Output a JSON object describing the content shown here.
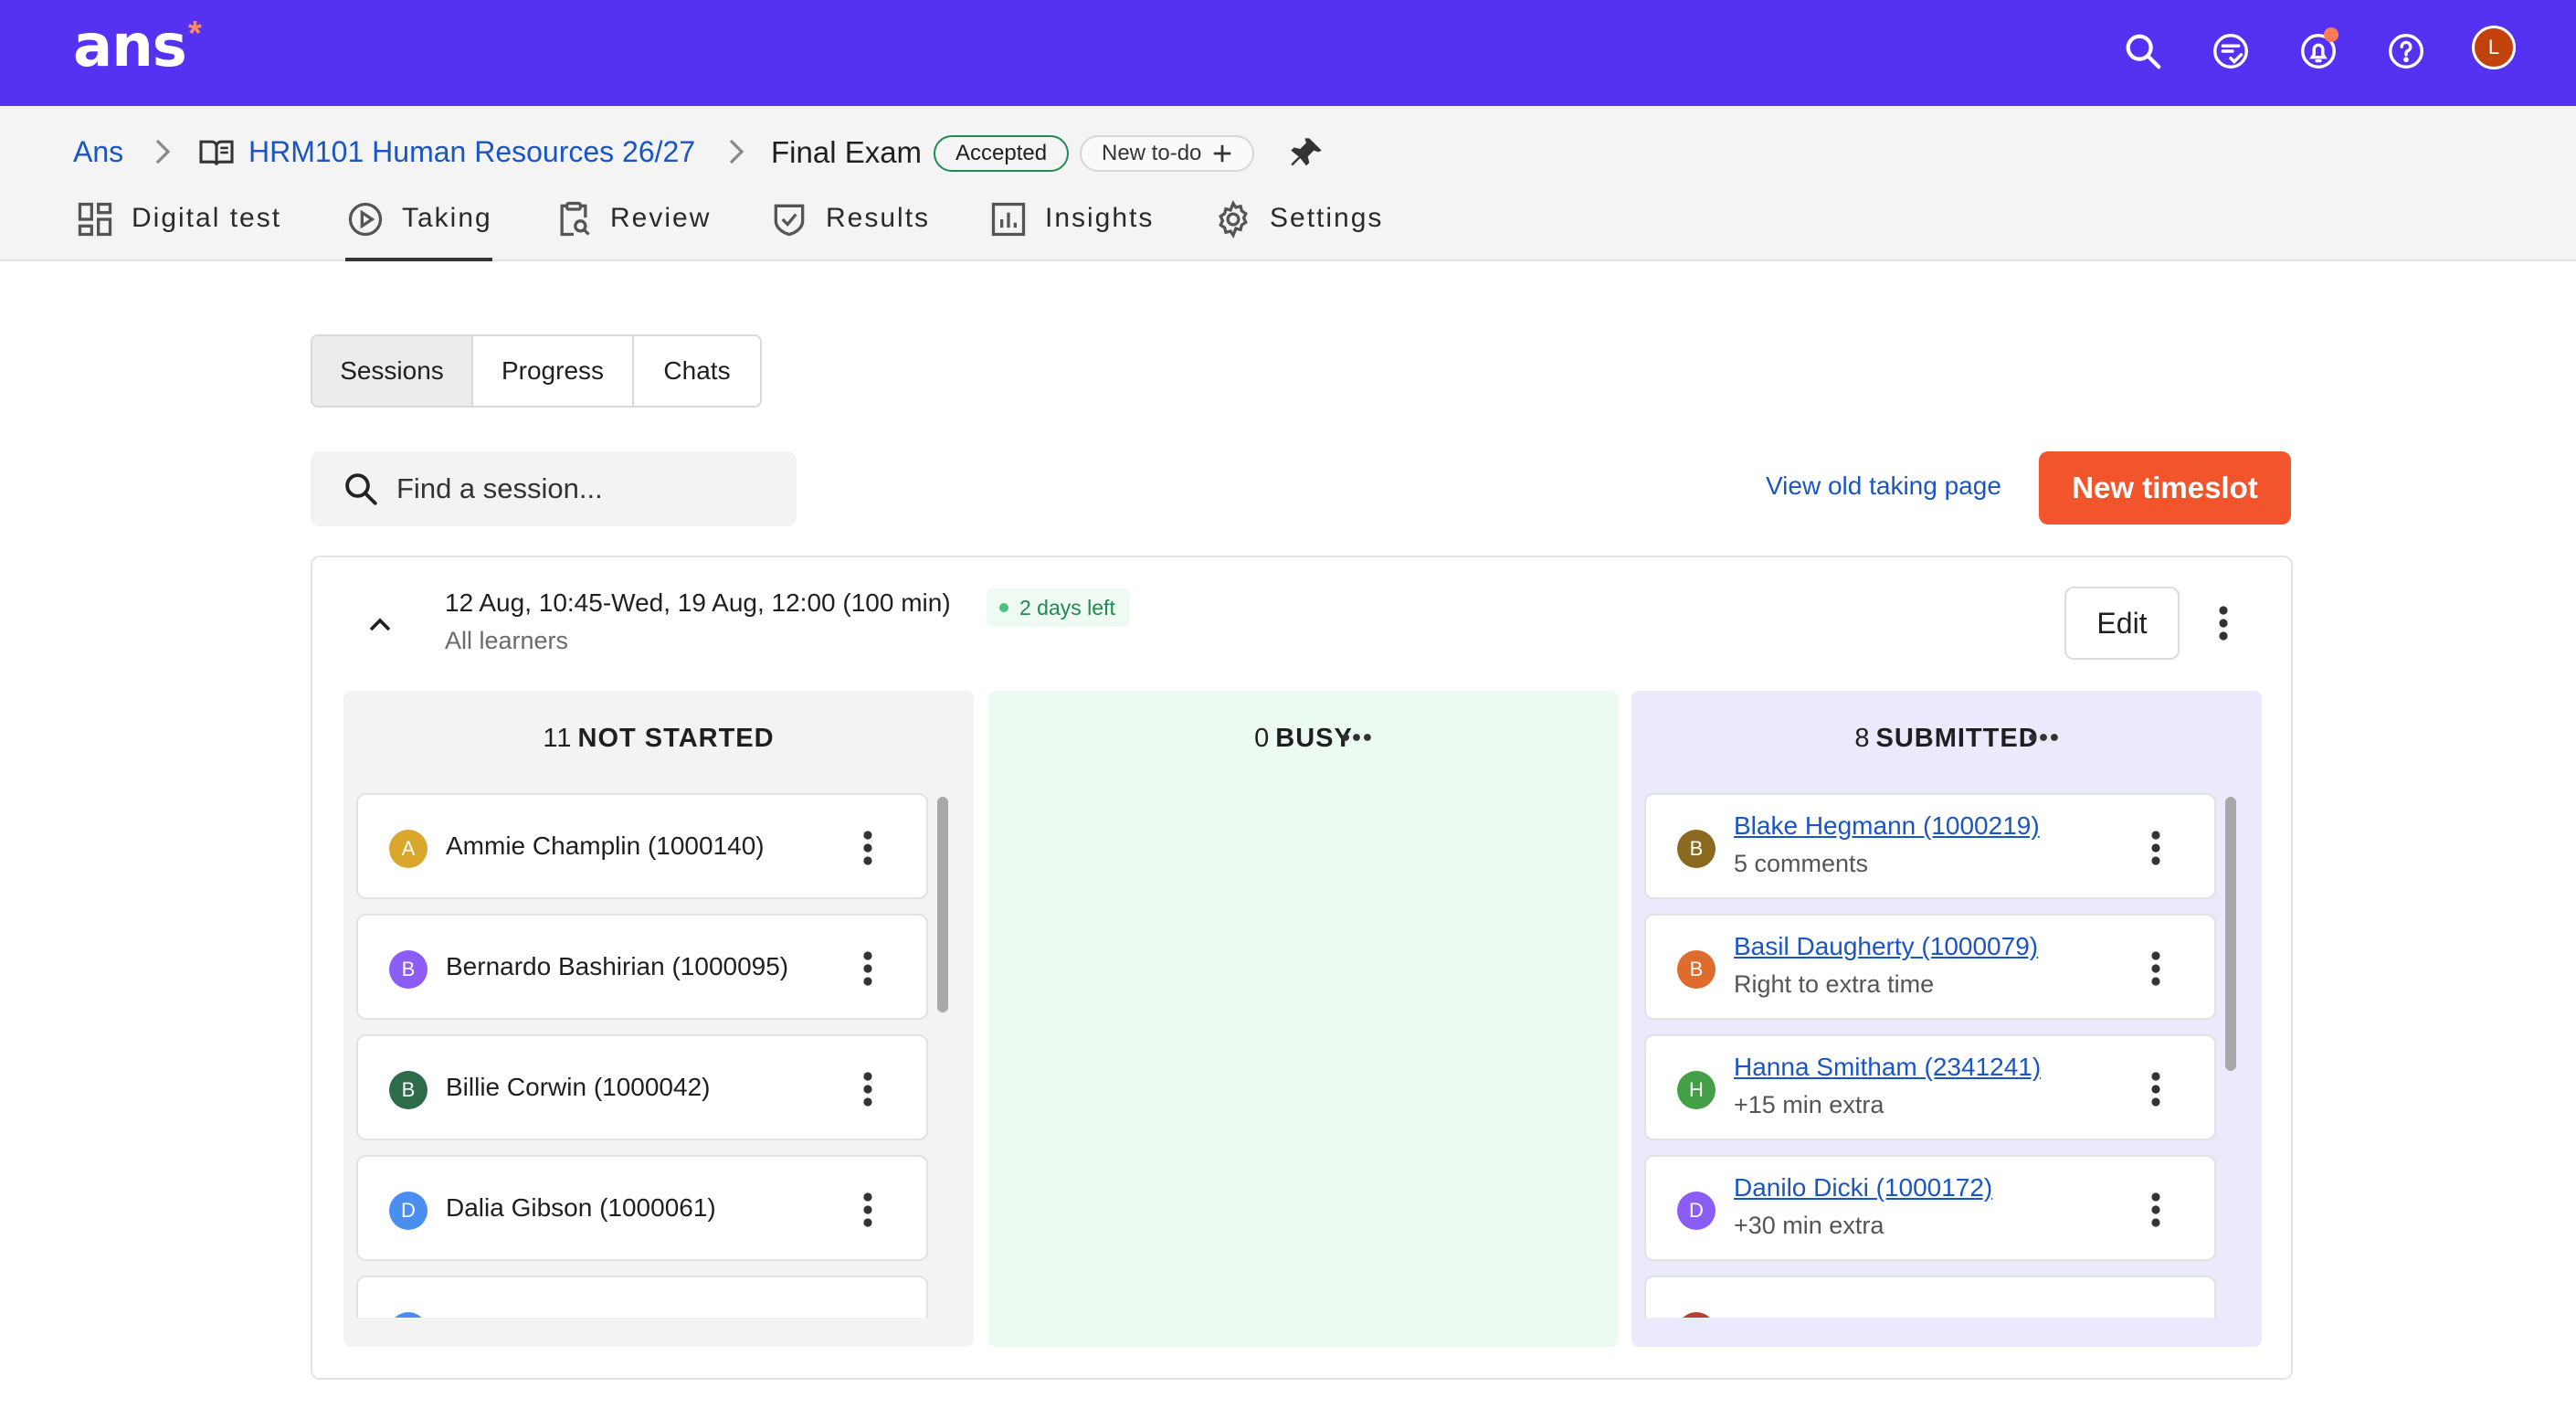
{
  "app": {
    "logo_text": "ans",
    "logo_mark": "*",
    "brand_color": "#5531f2",
    "accent_color": "#f2552c"
  },
  "topbar": {
    "icons": [
      "search-icon",
      "chat-icon",
      "bell-icon",
      "help-icon"
    ],
    "user_initial": "L"
  },
  "breadcrumb": {
    "root": "Ans",
    "course": "HRM101 Human Resources 26/27",
    "current": "Final Exam",
    "status_badge": "Accepted",
    "todo_label": "New to-do"
  },
  "nav": {
    "tabs": [
      {
        "label": "Digital test",
        "icon": "grid-icon"
      },
      {
        "label": "Taking",
        "icon": "play-circle-icon",
        "active": true
      },
      {
        "label": "Review",
        "icon": "clipboard-search-icon"
      },
      {
        "label": "Results",
        "icon": "shield-check-icon"
      },
      {
        "label": "Insights",
        "icon": "bar-chart-icon"
      },
      {
        "label": "Settings",
        "icon": "gear-icon"
      }
    ]
  },
  "view_tabs": {
    "items": [
      "Sessions",
      "Progress",
      "Chats"
    ],
    "active": "Sessions"
  },
  "search": {
    "placeholder": "Find a session..."
  },
  "actions": {
    "old_page_link": "View old taking page",
    "new_timeslot": "New timeslot"
  },
  "timeslot": {
    "time_range": "12 Aug, 10:45-Wed, 19 Aug, 12:00 (100 min)",
    "audience": "All learners",
    "status": "2 days left",
    "edit_label": "Edit"
  },
  "columns": {
    "not_started": {
      "count": "11",
      "label": "NOT STARTED",
      "items": [
        {
          "initial": "A",
          "name": "Ammie Champlin (1000140)",
          "color": "#d9a72b"
        },
        {
          "initial": "B",
          "name": "Bernardo Bashirian (1000095)",
          "color": "#8b5cf6"
        },
        {
          "initial": "B",
          "name": "Billie Corwin (1000042)",
          "color": "#2e6b4a"
        },
        {
          "initial": "D",
          "name": "Dalia Gibson (1000061)",
          "color": "#4a8ef0"
        }
      ]
    },
    "busy": {
      "count": "0",
      "label": "BUSY"
    },
    "submitted": {
      "count": "8",
      "label": "SUBMITTED",
      "items": [
        {
          "initial": "B",
          "name": "Blake Hegmann (1000219)",
          "note": "5 comments",
          "color": "#8b6a1f"
        },
        {
          "initial": "B",
          "name": "Basil Daugherty (1000079)",
          "note": "Right to extra time",
          "color": "#e06b2e"
        },
        {
          "initial": "H",
          "name": "Hanna Smitham (2341241)",
          "note": "+15 min extra",
          "color": "#43a047"
        },
        {
          "initial": "D",
          "name": "Danilo Dicki (1000172)",
          "note": "+30 min extra",
          "color": "#8b5cf6"
        }
      ]
    }
  }
}
